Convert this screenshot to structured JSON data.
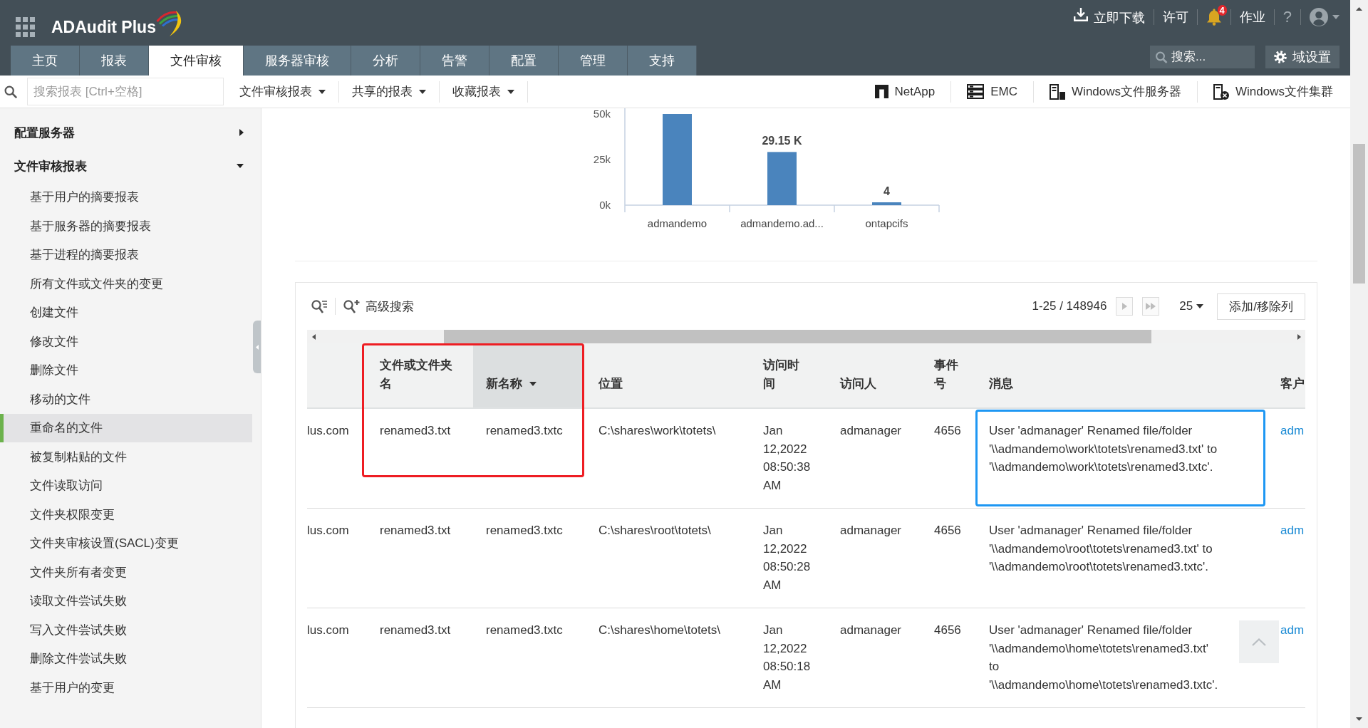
{
  "header": {
    "app_name": "ADAudit Plus",
    "actions": [
      {
        "kind": "download",
        "label": "立即下载"
      },
      {
        "kind": "link",
        "label": "许可"
      },
      {
        "kind": "notifications",
        "badge": "4"
      },
      {
        "kind": "link",
        "label": "作业"
      },
      {
        "kind": "help",
        "label": "?"
      },
      {
        "kind": "account"
      }
    ]
  },
  "nav": {
    "tabs": [
      {
        "label": "主页",
        "selected": false
      },
      {
        "label": "报表",
        "selected": false
      },
      {
        "label": "文件审核",
        "selected": true
      },
      {
        "label": "服务器审核",
        "selected": false
      },
      {
        "label": "分析",
        "selected": false
      },
      {
        "label": "告警",
        "selected": false
      },
      {
        "label": "配置",
        "selected": false
      },
      {
        "label": "管理",
        "selected": false
      },
      {
        "label": "支持",
        "selected": false
      }
    ],
    "search": {
      "placeholder": "搜索..."
    },
    "settings_button": "域设置"
  },
  "toolbar": {
    "search": {
      "placeholder": "搜索报表 [Ctrl+空格]"
    },
    "menus": [
      "文件审核报表",
      "共享的报表",
      "收藏报表"
    ],
    "sources": [
      {
        "kind": "netapp",
        "label": "NetApp"
      },
      {
        "kind": "emc",
        "label": "EMC"
      },
      {
        "kind": "windows_server",
        "label": "Windows文件服务器"
      },
      {
        "kind": "windows_cluster",
        "label": "Windows文件集群"
      }
    ]
  },
  "sidebar": {
    "sections": [
      {
        "label": "配置服务器",
        "expanded": false
      },
      {
        "label": "文件审核报表",
        "expanded": true,
        "children": [
          {
            "label": "基于用户的摘要报表",
            "selected": false
          },
          {
            "label": "基于服务器的摘要报表",
            "selected": false
          },
          {
            "label": "基于进程的摘要报表",
            "selected": false
          },
          {
            "label": "所有文件或文件夹的变更",
            "selected": false
          },
          {
            "label": "创建文件",
            "selected": false
          },
          {
            "label": "修改文件",
            "selected": false
          },
          {
            "label": "删除文件",
            "selected": false
          },
          {
            "label": "移动的文件",
            "selected": false
          },
          {
            "label": "重命名的文件",
            "selected": true
          },
          {
            "label": "被复制粘贴的文件",
            "selected": false
          },
          {
            "label": "文件读取访问",
            "selected": false
          },
          {
            "label": "文件夹权限变更",
            "selected": false
          },
          {
            "label": "文件夹审核设置(SACL)变更",
            "selected": false
          },
          {
            "label": "文件夹所有者变更",
            "selected": false
          },
          {
            "label": "读取文件尝试失败",
            "selected": false
          },
          {
            "label": "写入文件尝试失败",
            "selected": false
          },
          {
            "label": "删除文件尝试失败",
            "selected": false
          },
          {
            "label": "基于用户的变更",
            "selected": false
          }
        ]
      }
    ]
  },
  "chart": {
    "chart_data": {
      "type": "bar",
      "categories": [
        "admandemo",
        "admandemo.ad...",
        "ontapcifs"
      ],
      "values": [
        50000,
        29150,
        4
      ],
      "ylim": [
        0,
        50000
      ],
      "yticks": [
        {
          "value": 0,
          "label": "0k"
        },
        {
          "value": 25000,
          "label": "25k"
        },
        {
          "value": 50000,
          "label": "50k"
        }
      ],
      "value_labels": [
        null,
        "29.15 K",
        "4"
      ]
    }
  },
  "table": {
    "toolbar": {
      "advanced_search": "高级搜索",
      "pagination": "1-25 / 148946",
      "page_size": "25",
      "columns_button": "添加/移除列"
    },
    "columns": [
      {
        "sorted": false,
        "kind": "text"
      },
      {
        "label": "文件或文件夹名",
        "sorted": false,
        "kind": "text"
      },
      {
        "label": "新名称",
        "sorted": true,
        "kind": "text"
      },
      {
        "label": "位置",
        "sorted": false,
        "kind": "text"
      },
      {
        "label": "访问时间",
        "sorted": false,
        "kind": "text"
      },
      {
        "label": "访问人",
        "sorted": false,
        "kind": "text"
      },
      {
        "label": "事件号",
        "sorted": false,
        "kind": "text"
      },
      {
        "label": "消息",
        "sorted": false,
        "kind": "text"
      },
      {
        "label": "客户",
        "sorted": false,
        "kind": "link"
      }
    ],
    "rows": [
      {
        "cells": [
          "lus.com",
          "renamed3.txt",
          "renamed3.txtc",
          "C:\\shares\\work\\totets\\",
          "Jan 12,2022 08:50:38 AM",
          "admanager",
          "4656",
          "User 'admanager' Renamed file/folder '\\\\admandemo\\work\\totets\\renamed3.txt' to '\\\\admandemo\\work\\totets\\renamed3.txtc'.",
          "adm"
        ]
      },
      {
        "cells": [
          "lus.com",
          "renamed3.txt",
          "renamed3.txtc",
          "C:\\shares\\root\\totets\\",
          "Jan 12,2022 08:50:28 AM",
          "admanager",
          "4656",
          "User 'admanager' Renamed file/folder '\\\\admandemo\\root\\totets\\renamed3.txt' to '\\\\admandemo\\root\\totets\\renamed3.txtc'.",
          "adm"
        ]
      },
      {
        "cells": [
          "lus.com",
          "renamed3.txt",
          "renamed3.txtc",
          "C:\\shares\\home\\totets\\",
          "Jan 12,2022 08:50:18 AM",
          "admanager",
          "4656",
          "User 'admanager' Renamed file/folder '\\\\admandemo\\home\\totets\\renamed3.txt' to '\\\\admandemo\\home\\totets\\renamed3.txtc'.",
          "adm"
        ]
      }
    ],
    "highlights": [
      {
        "kind": "columns",
        "color": "#ee1d23"
      },
      {
        "kind": "cell",
        "color": "#1e97f3"
      }
    ]
  }
}
